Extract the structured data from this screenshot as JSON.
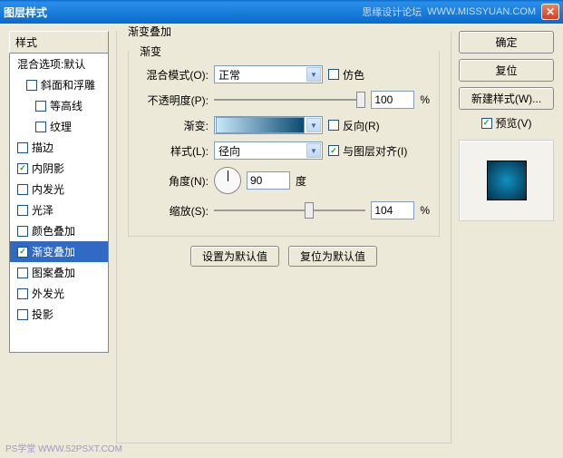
{
  "title": "图层样式",
  "watermark1": "思缘设计论坛",
  "watermark2": "WWW.MISSYUAN.COM",
  "left": {
    "header": "样式",
    "blend_options": "混合选项:默认",
    "items": [
      {
        "label": "斜面和浮雕",
        "checked": false,
        "cat": true
      },
      {
        "label": "等高线",
        "checked": false,
        "sub": true
      },
      {
        "label": "纹理",
        "checked": false,
        "sub": true
      },
      {
        "label": "描边",
        "checked": false
      },
      {
        "label": "内阴影",
        "checked": true
      },
      {
        "label": "内发光",
        "checked": false
      },
      {
        "label": "光泽",
        "checked": false
      },
      {
        "label": "颜色叠加",
        "checked": false
      },
      {
        "label": "渐变叠加",
        "checked": true,
        "selected": true
      },
      {
        "label": "图案叠加",
        "checked": false
      },
      {
        "label": "外发光",
        "checked": false
      },
      {
        "label": "投影",
        "checked": false
      }
    ]
  },
  "main": {
    "group_title": "渐变叠加",
    "inner_title": "渐变",
    "blend_mode_label": "混合模式(O):",
    "blend_mode_value": "正常",
    "dither_label": "仿色",
    "opacity_label": "不透明度(P):",
    "opacity_value": "100",
    "percent": "%",
    "gradient_label": "渐变:",
    "reverse_label": "反向(R)",
    "style_label": "样式(L):",
    "style_value": "径向",
    "align_label": "与图层对齐(I)",
    "angle_label": "角度(N):",
    "angle_value": "90",
    "degree": "度",
    "scale_label": "缩放(S):",
    "scale_value": "104",
    "set_default": "设置为默认值",
    "reset_default": "复位为默认值"
  },
  "right": {
    "ok": "确定",
    "reset": "复位",
    "new_style": "新建样式(W)...",
    "preview_label": "预览(V)"
  },
  "footer_wm": "PS学堂  WWW.52PSXT.COM"
}
